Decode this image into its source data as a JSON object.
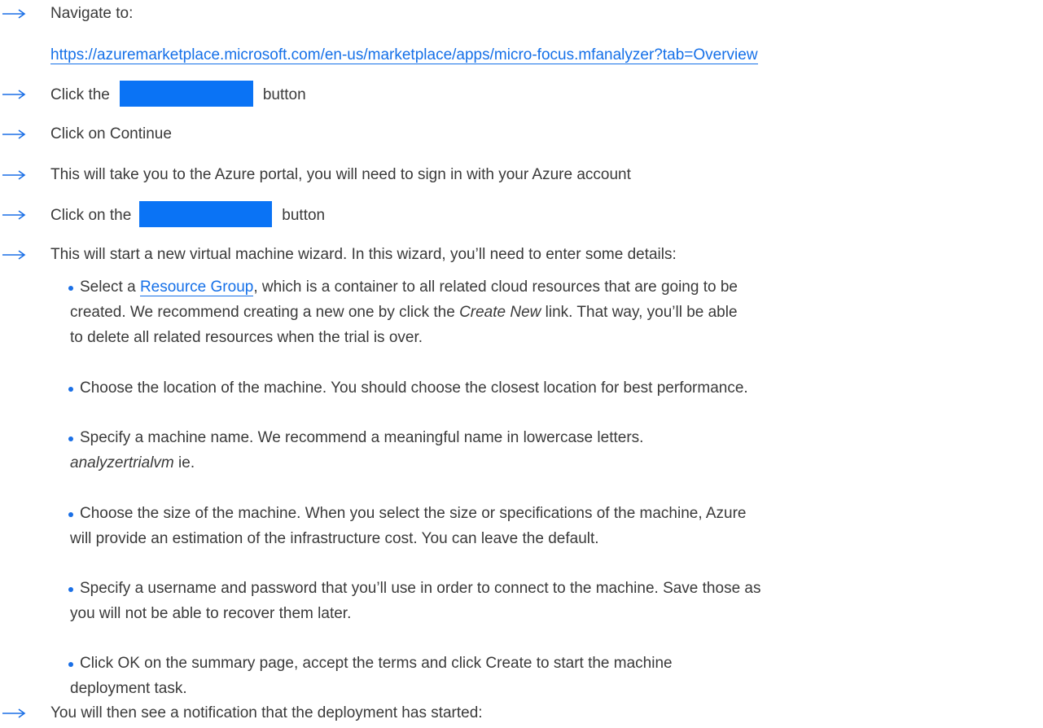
{
  "steps": [
    {
      "text": "Navigate to:"
    },
    {
      "link": "https://azuremarketplace.microsoft.com/en-us/marketplace/apps/micro-focus.mfanalyzer?tab=Overview"
    },
    {
      "before": "Click the",
      "after": "button",
      "placeholder_color": "#0a73f5"
    },
    {
      "text": "Click on Continue"
    },
    {
      "text": "This will take you to the Azure portal, you will need to sign in with your Azure account"
    },
    {
      "before": "Click on the",
      "after": "button",
      "placeholder_color": "#0a73f5"
    },
    {
      "text": "This will start a new virtual machine wizard. In this wizard, you’ll need to enter some details:"
    },
    {
      "text": "You will then see a notification that the deployment has started:"
    }
  ],
  "bullets": [
    {
      "pre": "Select a ",
      "link": "Resource Group",
      "post1": ", which is a container to all related cloud resources that are going to be",
      "line2_pre": "created. We recommend creating a new one by click the ",
      "line2_em": "Create New",
      "line2_post": " link. That way, you’ll be able",
      "line3": "to delete all related resources when the trial is over."
    },
    {
      "line1": "Choose the location of the machine. You should choose the closest location for best performance."
    },
    {
      "line1": "Specify a machine name. We recommend a meaningful name in lowercase letters.",
      "line2_em": "analyzertrialvm",
      "line2_post": " ie."
    },
    {
      "line1": "Choose the size of the machine. When you select the size or specifications of the machine, Azure",
      "line2": "will provide an estimation of the infrastructure cost. You can leave the default."
    },
    {
      "line1": "Specify a username and password that you’ll use in order to connect to the machine. Save those as",
      "line2": "you will not be able to recover them later."
    },
    {
      "line1": "Click OK on the summary page, accept the terms and click Create to start the machine",
      "line2": "deployment task."
    }
  ],
  "colors": {
    "accent": "#1a6fe6",
    "button_placeholder": "#0a73f5",
    "text": "#3a3a3a"
  },
  "icons": {
    "step_marker": "arrow-right-icon",
    "bullet_marker": "bullet-dot-icon"
  }
}
